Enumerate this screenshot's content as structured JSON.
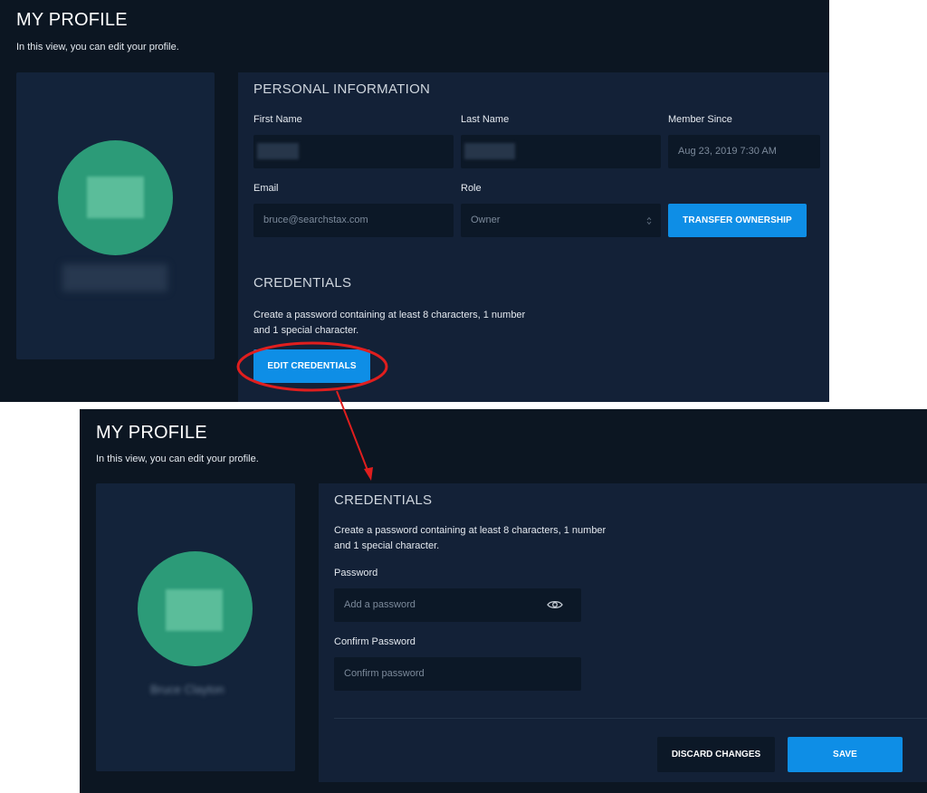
{
  "top_screen": {
    "page_title": "MY PROFILE",
    "page_subtitle": "In this view, you can edit your profile.",
    "personal_info": {
      "title": "PERSONAL INFORMATION",
      "first_name_label": "First Name",
      "last_name_label": "Last Name",
      "member_since_label": "Member Since",
      "member_since_value": "Aug 23, 2019 7:30 AM",
      "email_label": "Email",
      "email_value": "bruce@searchstax.com",
      "role_label": "Role",
      "role_value": "Owner",
      "transfer_button": "TRANSFER OWNERSHIP"
    },
    "credentials": {
      "title": "CREDENTIALS",
      "description_line1": "Create a password containing at least 8 characters, 1 number",
      "description_line2": "and 1 special character.",
      "edit_button": "EDIT CREDENTIALS"
    }
  },
  "bottom_screen": {
    "page_title": "MY PROFILE",
    "page_subtitle": "In this view, you can edit your profile.",
    "profile_name": "Bruce Clayton",
    "credentials": {
      "title": "CREDENTIALS",
      "description_line1": "Create a password containing at least 8 characters, 1 number",
      "description_line2": "and 1 special character.",
      "password_label": "Password",
      "password_placeholder": "Add a password",
      "confirm_label": "Confirm Password",
      "confirm_placeholder": "Confirm password",
      "discard_button": "DISCARD CHANGES",
      "save_button": "SAVE"
    }
  },
  "icons": {
    "password_visibility": "eye-icon",
    "role_select": "select-arrows-icon"
  },
  "colors": {
    "background": "#0c1622",
    "card": "#13233a",
    "accent": "#0e8ee6",
    "avatar": "#2c9b78",
    "annotation": "#e01e1e"
  }
}
